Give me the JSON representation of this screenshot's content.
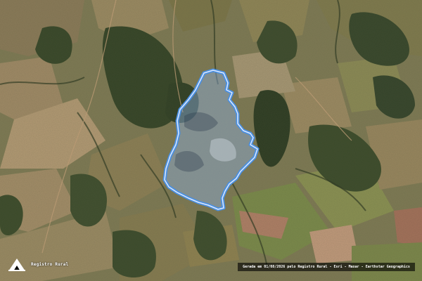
{
  "map": {
    "imagery": "satellite",
    "feature": {
      "type": "property-boundary",
      "outline_color": "#4a90e2",
      "fill_color": "#8fb3e6"
    }
  },
  "logo": {
    "text": "Registro Rural",
    "icon": "registro-rural-logo"
  },
  "attribution": {
    "text": "Gerada em 01/08/2026 pelo Registro Rural - Esri - Maxar - Earthstar Geographics"
  }
}
